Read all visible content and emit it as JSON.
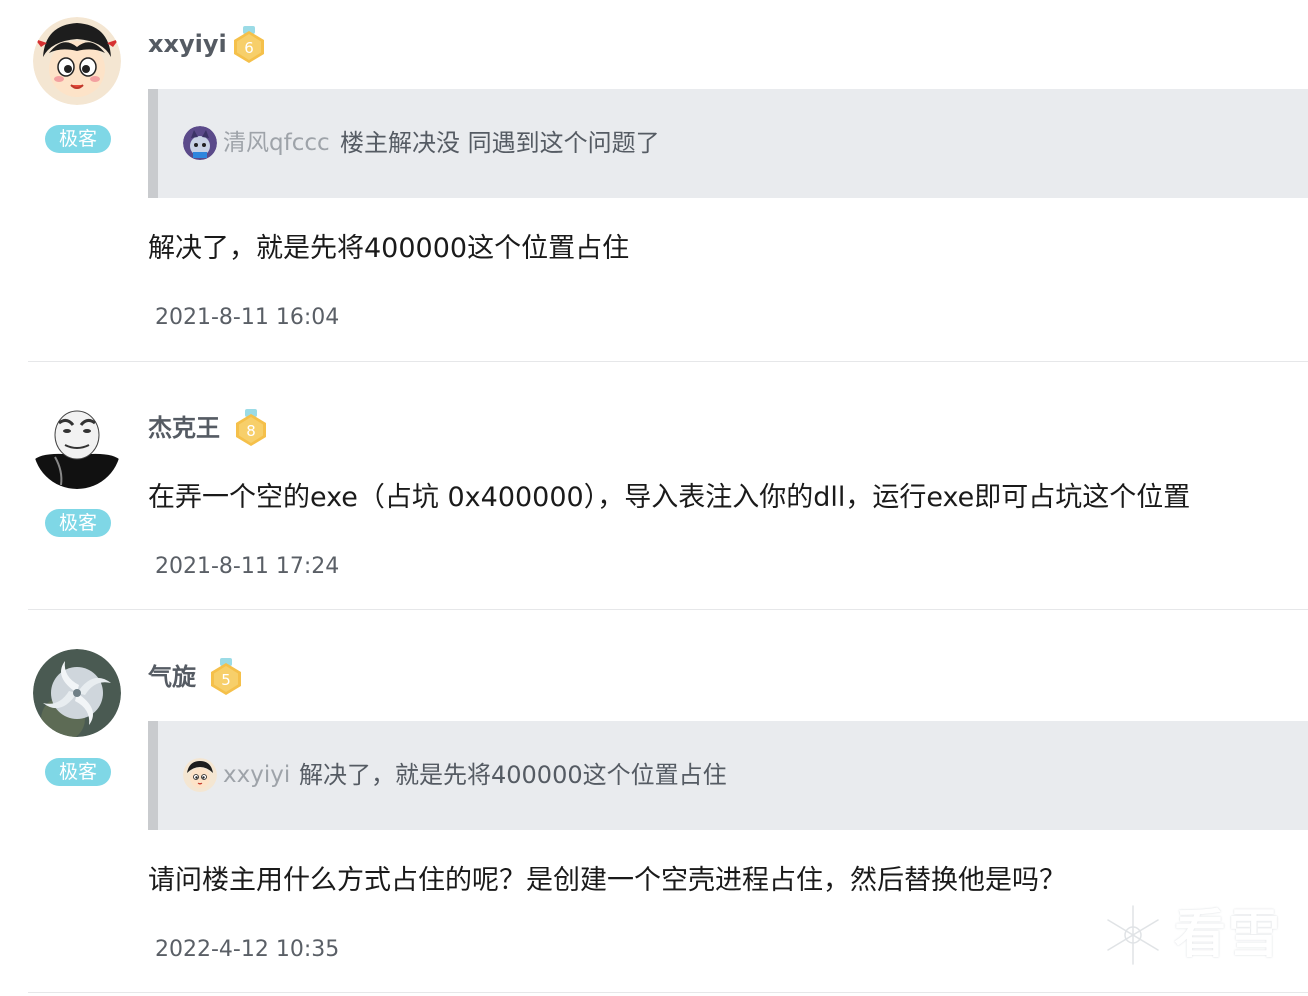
{
  "posts": [
    {
      "username": "xxyiyi",
      "level": "6",
      "tag": "极客",
      "quote": {
        "username": "清风qfccc",
        "text": "楼主解决没 同遇到这个问题了"
      },
      "content": "解决了，就是先将400000这个位置占住",
      "time": "2021-8-11 16:04"
    },
    {
      "username": "杰克王",
      "level": "8",
      "tag": "极客",
      "content": "在弄一个空的exe（占坑 0x400000），导入表注入你的dll，运行exe即可占坑这个位置",
      "time": "2021-8-11 17:24"
    },
    {
      "username": "气旋",
      "level": "5",
      "tag": "极客",
      "quote": {
        "username": "xxyiyi",
        "text": "解决了，就是先将400000这个位置占住"
      },
      "content": "请问楼主用什么方式占住的呢？是创建一个空壳进程占住，然后替换他是吗？",
      "time": "2022-4-12 10:35"
    }
  ],
  "watermark": {
    "text": "看雪"
  },
  "colors": {
    "tag_bg": "#7fd7e6",
    "badge_gold": "#f5c04a",
    "quote_bg": "#e9ebee",
    "quote_border": "#c9cbce"
  }
}
